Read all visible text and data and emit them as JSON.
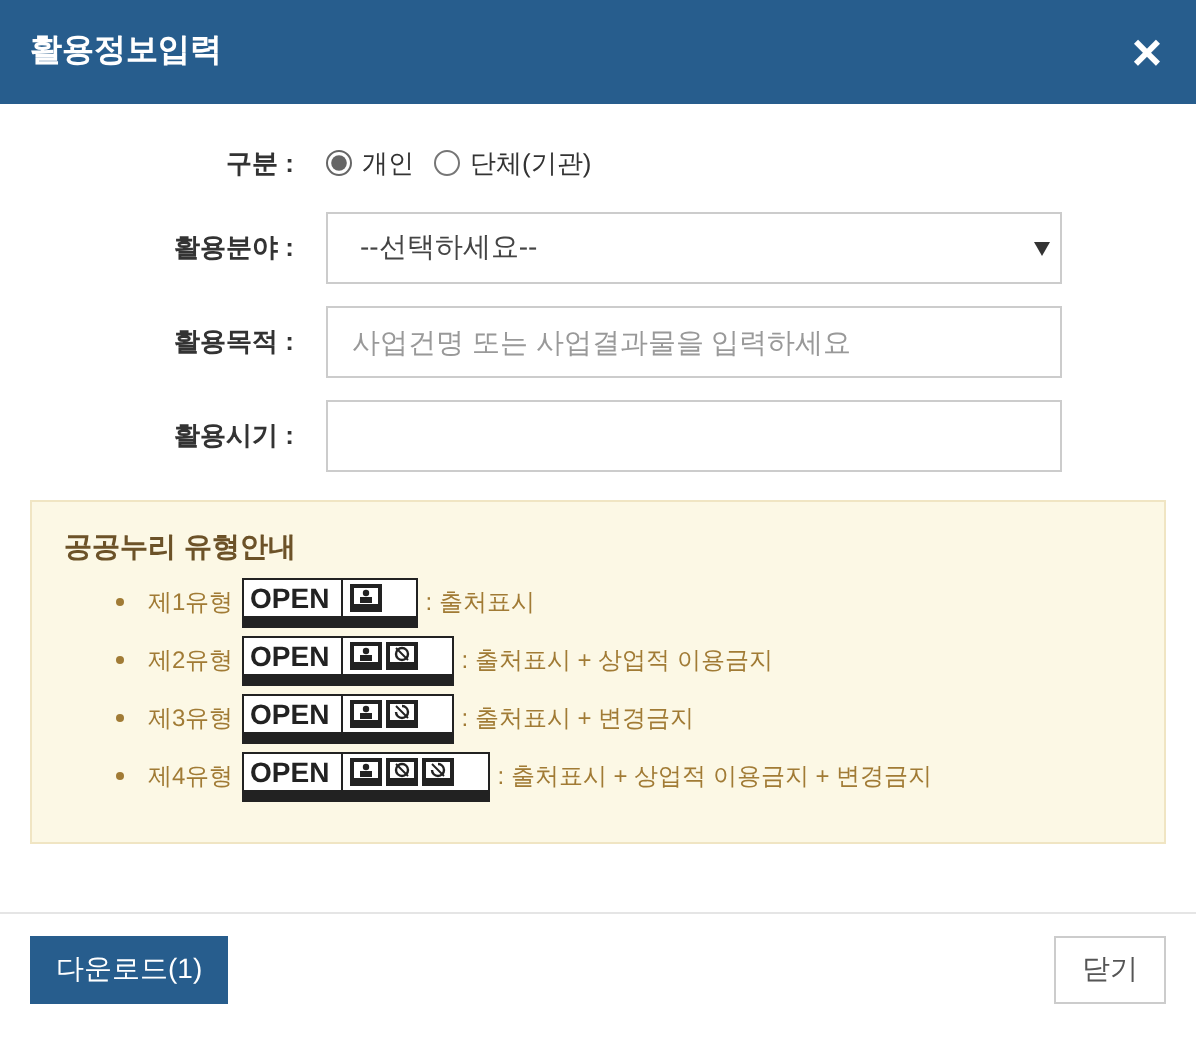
{
  "dialog": {
    "title": "활용정보입력",
    "close": "×"
  },
  "form": [
    {
      "kind": "radio",
      "label": "구분 :",
      "options": [
        {
          "label": "개인",
          "selected": true
        },
        {
          "label": "단체(기관)",
          "selected": false
        }
      ]
    },
    {
      "kind": "select",
      "label": "활용분야 :",
      "value": "--선택하세요--"
    },
    {
      "kind": "text",
      "label": "활용목적 :",
      "placeholder": "사업건명 또는 사업결과물을 입력하세요"
    },
    {
      "kind": "text",
      "label": "활용시기 :"
    }
  ],
  "guide": {
    "title": "공공누리 유형안내",
    "items": [
      {
        "label": "제1유형",
        "badge": "OPEN",
        "kind": "by",
        "description": ": 출처표시"
      },
      {
        "label": "제2유형",
        "badge": "OPEN",
        "kind": "by-nc",
        "description": ": 출처표시 + 상업적 이용금지"
      },
      {
        "label": "제3유형",
        "badge": "OPEN",
        "kind": "by-nd",
        "description": ": 출처표시 + 변경금지"
      },
      {
        "label": "제4유형",
        "badge": "OPEN",
        "kind": "by-nc-nd",
        "description": ": 출처표시 + 상업적 이용금지 + 변경금지"
      }
    ]
  },
  "buttons": [
    {
      "label": "다운로드(1)",
      "kind": "primary"
    },
    {
      "label": "닫기",
      "kind": "secondary"
    }
  ]
}
